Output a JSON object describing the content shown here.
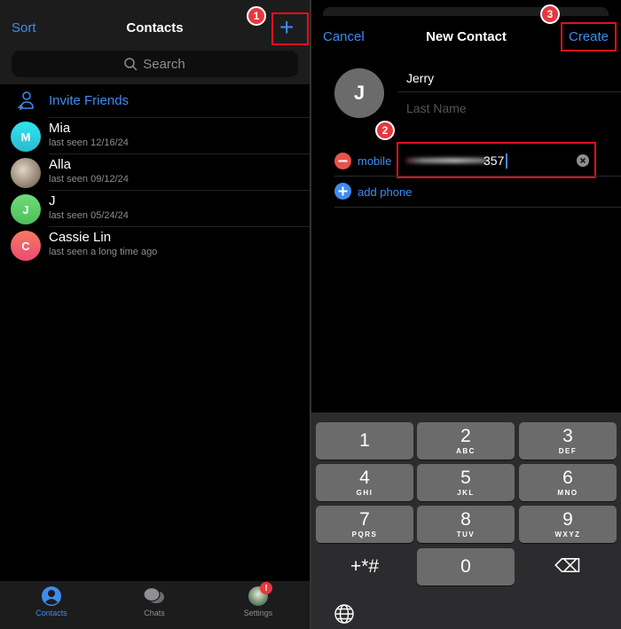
{
  "contacts_screen": {
    "sort_label": "Sort",
    "title": "Contacts",
    "search_placeholder": "Search",
    "invite_label": "Invite Friends",
    "contacts": [
      {
        "initial": "M",
        "name": "Mia",
        "status": "last seen 12/16/24",
        "color": "#22d3e0"
      },
      {
        "initial": "",
        "name": "Alla",
        "status": "last seen 09/12/24",
        "color": "#b8a99a"
      },
      {
        "initial": "J",
        "name": "J",
        "status": "last seen 05/24/24",
        "color": "#5fd068"
      },
      {
        "initial": "C",
        "name": "Cassie Lin",
        "status": "last seen a long time ago",
        "color": "#f0606a"
      }
    ],
    "tabs": [
      {
        "label": "Contacts",
        "active": true
      },
      {
        "label": "Chats"
      },
      {
        "label": "Settings",
        "badge": "!"
      }
    ]
  },
  "new_contact": {
    "cancel_label": "Cancel",
    "title": "New Contact",
    "create_label": "Create",
    "avatar_initial": "J",
    "first_name": "Jerry",
    "last_name_placeholder": "Last Name",
    "phone_label": "mobile",
    "phone_value_visible": "357",
    "add_phone_label": "add phone"
  },
  "annotations": [
    "1",
    "2",
    "3"
  ],
  "keypad": [
    {
      "d": "1",
      "s": ""
    },
    {
      "d": "2",
      "s": "ABC"
    },
    {
      "d": "3",
      "s": "DEF"
    },
    {
      "d": "4",
      "s": "GHI"
    },
    {
      "d": "5",
      "s": "JKL"
    },
    {
      "d": "6",
      "s": "MNO"
    },
    {
      "d": "7",
      "s": "PQRS"
    },
    {
      "d": "8",
      "s": "TUV"
    },
    {
      "d": "9",
      "s": "WXYZ"
    },
    {
      "d": "+*#",
      "s": ""
    },
    {
      "d": "0",
      "s": ""
    },
    {
      "d": "⌫",
      "s": ""
    }
  ],
  "colors": {
    "accent": "#3e8cf0",
    "annotation_red": "#e0101c"
  }
}
